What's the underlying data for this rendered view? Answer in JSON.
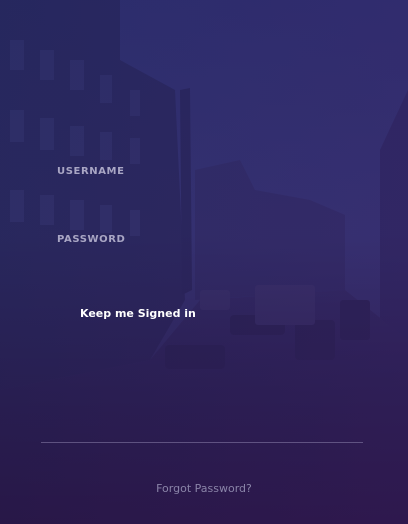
{
  "login": {
    "username_label": "USERNAME",
    "username_value": "",
    "password_label": "PASSWORD",
    "password_value": "",
    "remember_label": "Keep me Signed in",
    "remember_checked": false,
    "forgot_label": "Forgot Password?"
  },
  "colors": {
    "overlay_top": "#22245f",
    "overlay_bottom": "#2a1646",
    "label_text": "#a9a6c4",
    "link_text": "#8a84a8",
    "divider": "#a096be"
  }
}
